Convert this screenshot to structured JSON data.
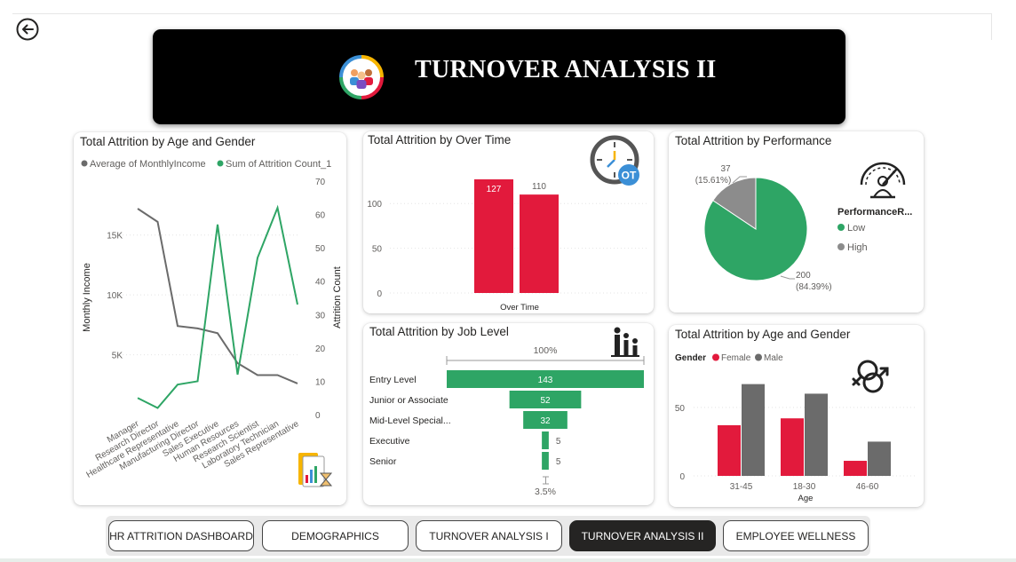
{
  "header": {
    "title": "TURNOVER ANALYSIS II"
  },
  "nav": [
    {
      "label": "HR ATTRITION DASHBOARD",
      "active": false
    },
    {
      "label": "DEMOGRAPHICS",
      "active": false
    },
    {
      "label": "TURNOVER ANALYSIS I",
      "active": false
    },
    {
      "label": "TURNOVER ANALYSIS II",
      "active": true
    },
    {
      "label": "EMPLOYEE WELLNESS",
      "active": false
    }
  ],
  "colors": {
    "green": "#2ea565",
    "grey": "#6b6b6b",
    "red": "#e21a3c",
    "pie_grey": "#8c8c8c"
  },
  "chart_data": [
    {
      "id": "role",
      "type": "line",
      "title": "Total Attrition by Age and Gender",
      "categories": [
        "Manager",
        "Research Director",
        "Healthcare Representative",
        "Manufacturing Director",
        "Sales Executive",
        "Human Resources",
        "Research Scientist",
        "Laboratory Technician",
        "Sales Representative"
      ],
      "series": [
        {
          "name": "Average of MonthlyIncome",
          "axis": "left",
          "values": [
            17200,
            16100,
            7400,
            7200,
            6800,
            4300,
            3300,
            3300,
            2600
          ]
        },
        {
          "name": "Sum of Attrition Count_1",
          "axis": "right",
          "values": [
            5,
            2,
            9,
            10,
            57,
            12,
            47,
            62,
            33
          ]
        }
      ],
      "ylabel": "Monthly Income",
      "y2label": "Attrition Count",
      "yticks": [
        "5K",
        "10K",
        "15K"
      ],
      "y2ticks": [
        "0",
        "10",
        "20",
        "30",
        "40",
        "50",
        "60",
        "70"
      ],
      "ylim": [
        0,
        19500
      ],
      "y2lim": [
        0,
        70
      ]
    },
    {
      "id": "overtime",
      "type": "bar",
      "title": "Total Attrition by Over Time",
      "categories": [
        "",
        ""
      ],
      "values": [
        127,
        110
      ],
      "xlabel": "Over Time",
      "yticks": [
        "0",
        "50",
        "100"
      ],
      "ylim": [
        0,
        127
      ]
    },
    {
      "id": "performance",
      "type": "pie",
      "title": "Total Attrition by Performance",
      "legend_title": "PerformanceR...",
      "slices": [
        {
          "name": "Low",
          "value": 200,
          "label": "200",
          "pct": "(84.39%)"
        },
        {
          "name": "High",
          "value": 37,
          "label": "37",
          "pct": "(15.61%)"
        }
      ]
    },
    {
      "id": "joblevel",
      "type": "bar",
      "title": "Total Attrition by Job Level",
      "categories": [
        "Entry Level",
        "Junior or Associate",
        "Mid-Level Special...",
        "Executive",
        "Senior"
      ],
      "values": [
        143,
        52,
        32,
        5,
        5
      ],
      "top_label": "100%",
      "bottom_label": "3.5%"
    },
    {
      "id": "agegender",
      "type": "bar",
      "title": "Total Attrition by Age and Gender",
      "legend_title": "Gender",
      "categories": [
        "31-45",
        "18-30",
        "46-60"
      ],
      "series": [
        {
          "name": "Female",
          "values": [
            37,
            42,
            11
          ]
        },
        {
          "name": "Male",
          "values": [
            67,
            60,
            25
          ]
        }
      ],
      "xlabel": "Age",
      "yticks": [
        "0",
        "50"
      ],
      "ylim": [
        0,
        70
      ]
    }
  ]
}
